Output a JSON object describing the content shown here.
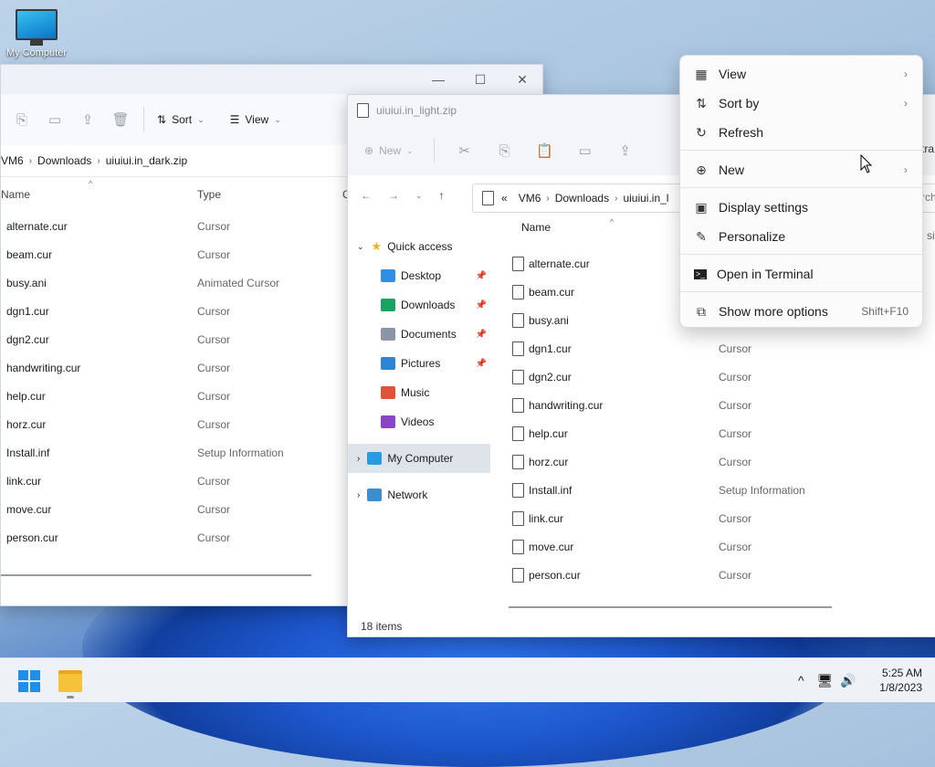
{
  "desktop": {
    "icon_label": "My Computer"
  },
  "window_back": {
    "toolbar": {
      "sort_label": "Sort",
      "view_label": "View"
    },
    "address": [
      "VM6",
      "Downloads",
      "uiuiui.in_dark.zip"
    ],
    "columns": {
      "name": "Name",
      "type": "Type",
      "extra": "C"
    },
    "files": [
      {
        "name": "alternate.cur",
        "type": "Cursor"
      },
      {
        "name": "beam.cur",
        "type": "Cursor"
      },
      {
        "name": "busy.ani",
        "type": "Animated Cursor"
      },
      {
        "name": "dgn1.cur",
        "type": "Cursor"
      },
      {
        "name": "dgn2.cur",
        "type": "Cursor"
      },
      {
        "name": "handwriting.cur",
        "type": "Cursor"
      },
      {
        "name": "help.cur",
        "type": "Cursor"
      },
      {
        "name": "horz.cur",
        "type": "Cursor"
      },
      {
        "name": "Install.inf",
        "type": "Setup Information"
      },
      {
        "name": "link.cur",
        "type": "Cursor"
      },
      {
        "name": "move.cur",
        "type": "Cursor"
      },
      {
        "name": "person.cur",
        "type": "Cursor"
      }
    ]
  },
  "window_front": {
    "title": "uiuiui.in_light.zip",
    "toolbar": {
      "new_label": "New"
    },
    "address": [
      "VM6",
      "Downloads",
      "uiuiui.in_l"
    ],
    "address_prefix": "«",
    "columns": {
      "name": "Name"
    },
    "nav": {
      "quick_access": "Quick access",
      "items": [
        {
          "label": "Desktop",
          "color": "#2f8fe6",
          "pinned": true
        },
        {
          "label": "Downloads",
          "color": "#1aa260",
          "pinned": true
        },
        {
          "label": "Documents",
          "color": "#8a96a8",
          "pinned": true
        },
        {
          "label": "Pictures",
          "color": "#2b84d6",
          "pinned": true
        },
        {
          "label": "Music",
          "color": "#e0533b",
          "pinned": false
        },
        {
          "label": "Videos",
          "color": "#8b45c9",
          "pinned": false
        }
      ],
      "my_computer": "My Computer",
      "network": "Network"
    },
    "files": [
      {
        "name": "alternate.cur",
        "type": ""
      },
      {
        "name": "beam.cur",
        "type": ""
      },
      {
        "name": "busy.ani",
        "type": ""
      },
      {
        "name": "dgn1.cur",
        "type": "Cursor"
      },
      {
        "name": "dgn2.cur",
        "type": "Cursor"
      },
      {
        "name": "handwriting.cur",
        "type": "Cursor"
      },
      {
        "name": "help.cur",
        "type": "Cursor"
      },
      {
        "name": "horz.cur",
        "type": "Cursor"
      },
      {
        "name": "Install.inf",
        "type": "Setup Information"
      },
      {
        "name": "link.cur",
        "type": "Cursor"
      },
      {
        "name": "move.cur",
        "type": "Cursor"
      },
      {
        "name": "person.cur",
        "type": "Cursor"
      }
    ],
    "status": "18 items",
    "partial_right_text": [
      "tra",
      "rch",
      "l si"
    ]
  },
  "context_menu": {
    "items": {
      "view": "View",
      "sort_by": "Sort by",
      "refresh": "Refresh",
      "new": "New",
      "display_settings": "Display settings",
      "personalize": "Personalize",
      "open_terminal": "Open in Terminal",
      "show_more": "Show more options",
      "show_more_shortcut": "Shift+F10"
    }
  },
  "taskbar": {
    "time": "5:25 AM",
    "date": "1/8/2023"
  }
}
